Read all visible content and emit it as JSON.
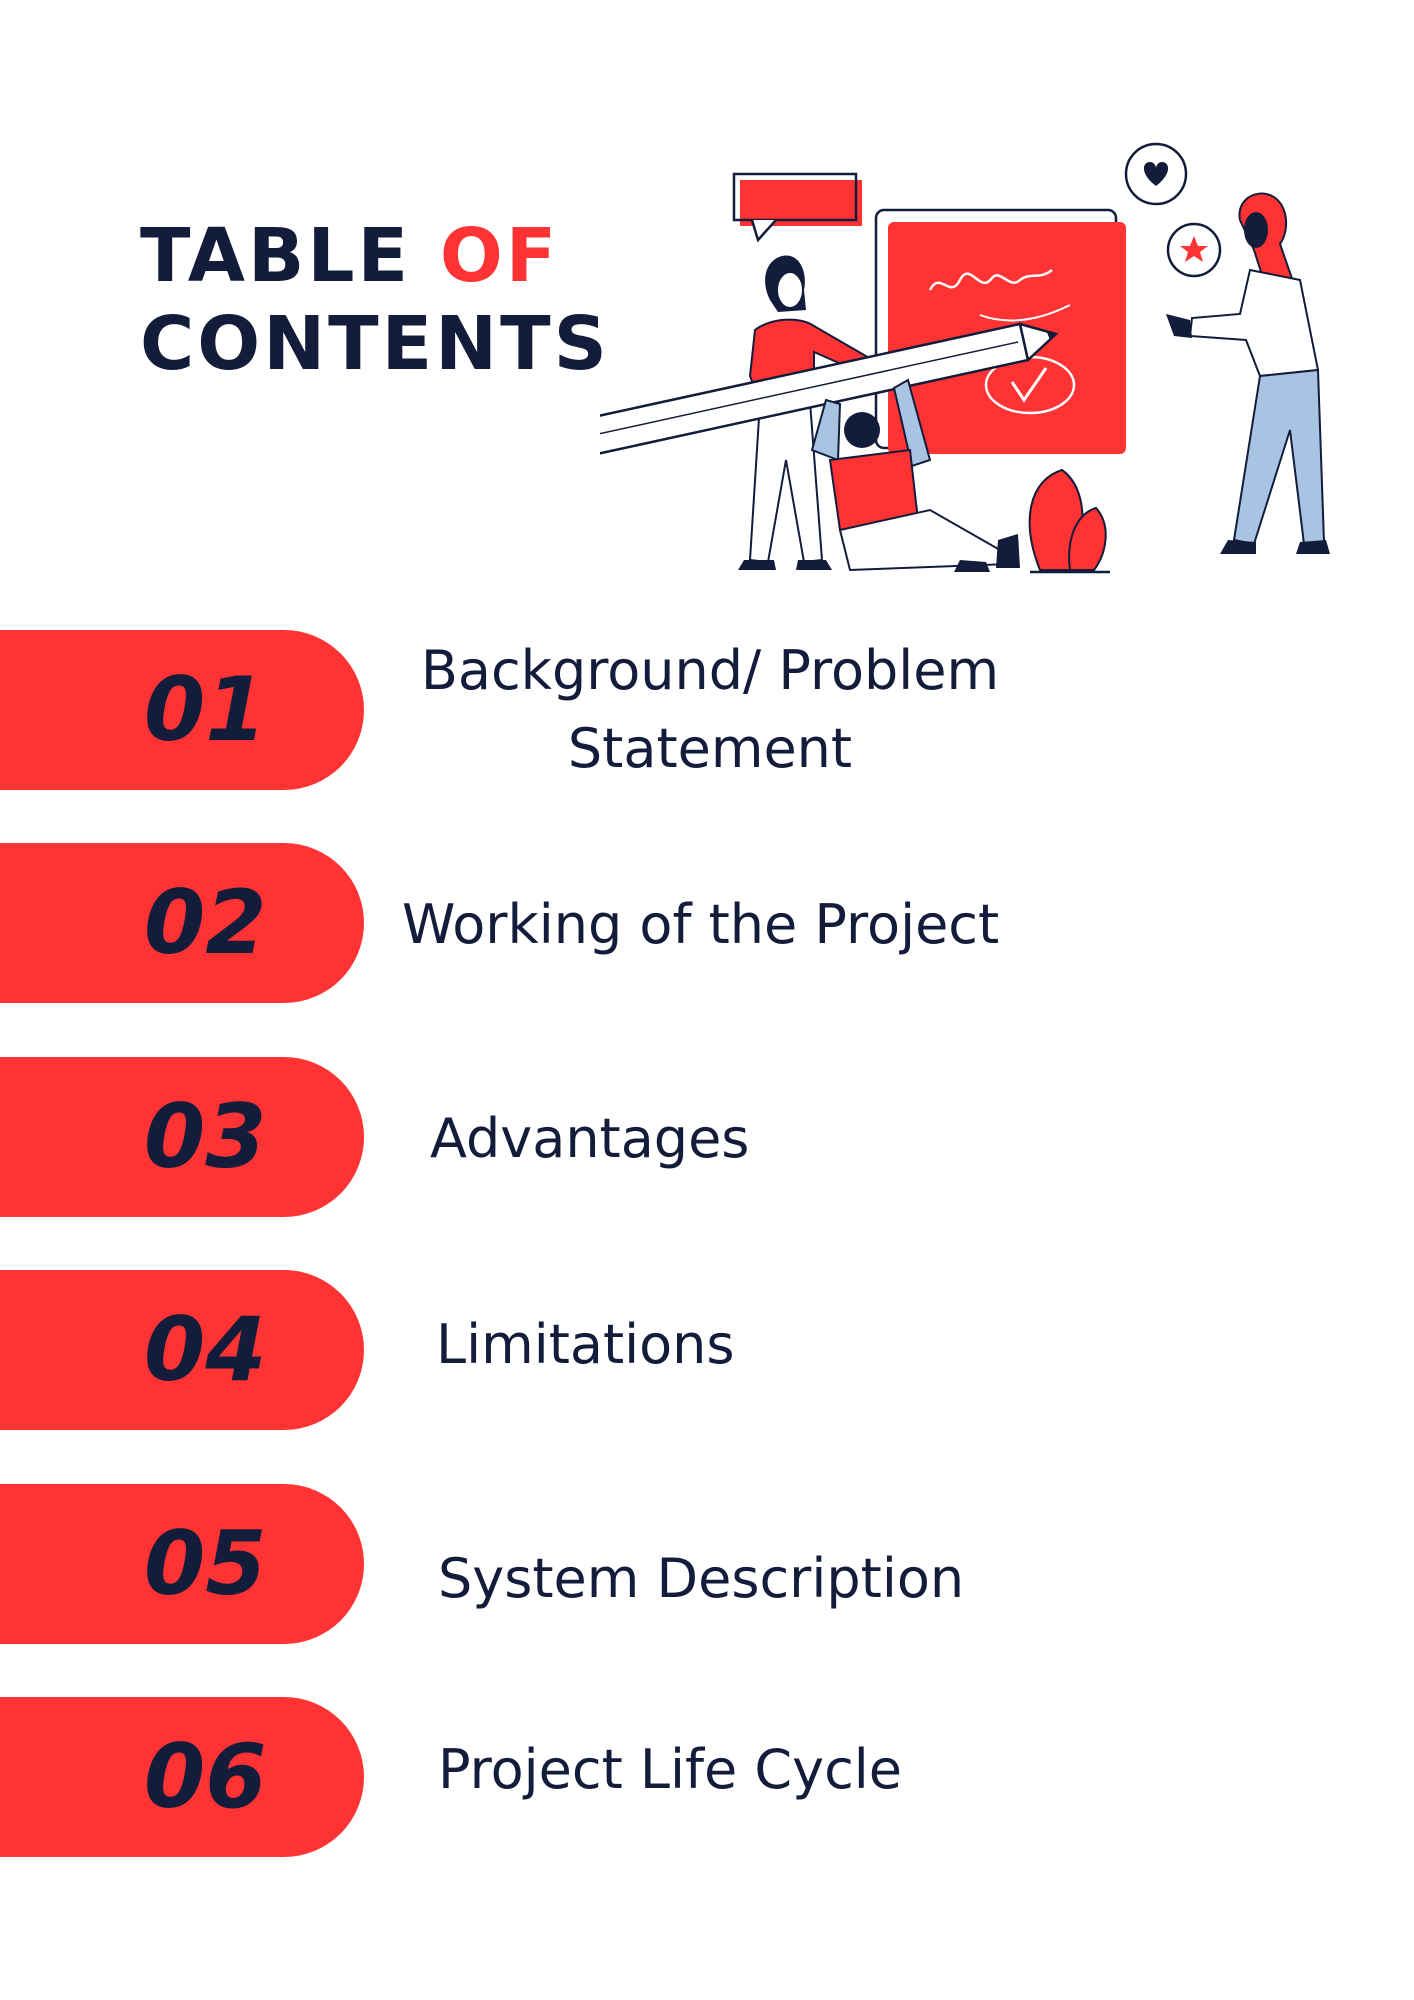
{
  "header": {
    "title_word1": "TABLE",
    "title_word2": "OF",
    "title_line2": "CONTENTS"
  },
  "colors": {
    "accent": "#ff3333",
    "navy": "#131c3a",
    "light_blue": "#a9c4e3",
    "background": "#ffffff"
  },
  "illustration": {
    "icons": [
      "speech-bubble-icon",
      "heart-icon",
      "star-icon",
      "checkmark-icon",
      "pencil-icon",
      "plant-icon"
    ]
  },
  "toc": {
    "items": [
      {
        "number": "01",
        "label_line1": "Background/ Problem",
        "label_line2": "Statement"
      },
      {
        "number": "02",
        "label": "Working of the Project"
      },
      {
        "number": "03",
        "label": "Advantages"
      },
      {
        "number": "04",
        "label": "Limitations"
      },
      {
        "number": "05",
        "label": "System Description"
      },
      {
        "number": "06",
        "label": "Project Life Cycle"
      }
    ]
  }
}
